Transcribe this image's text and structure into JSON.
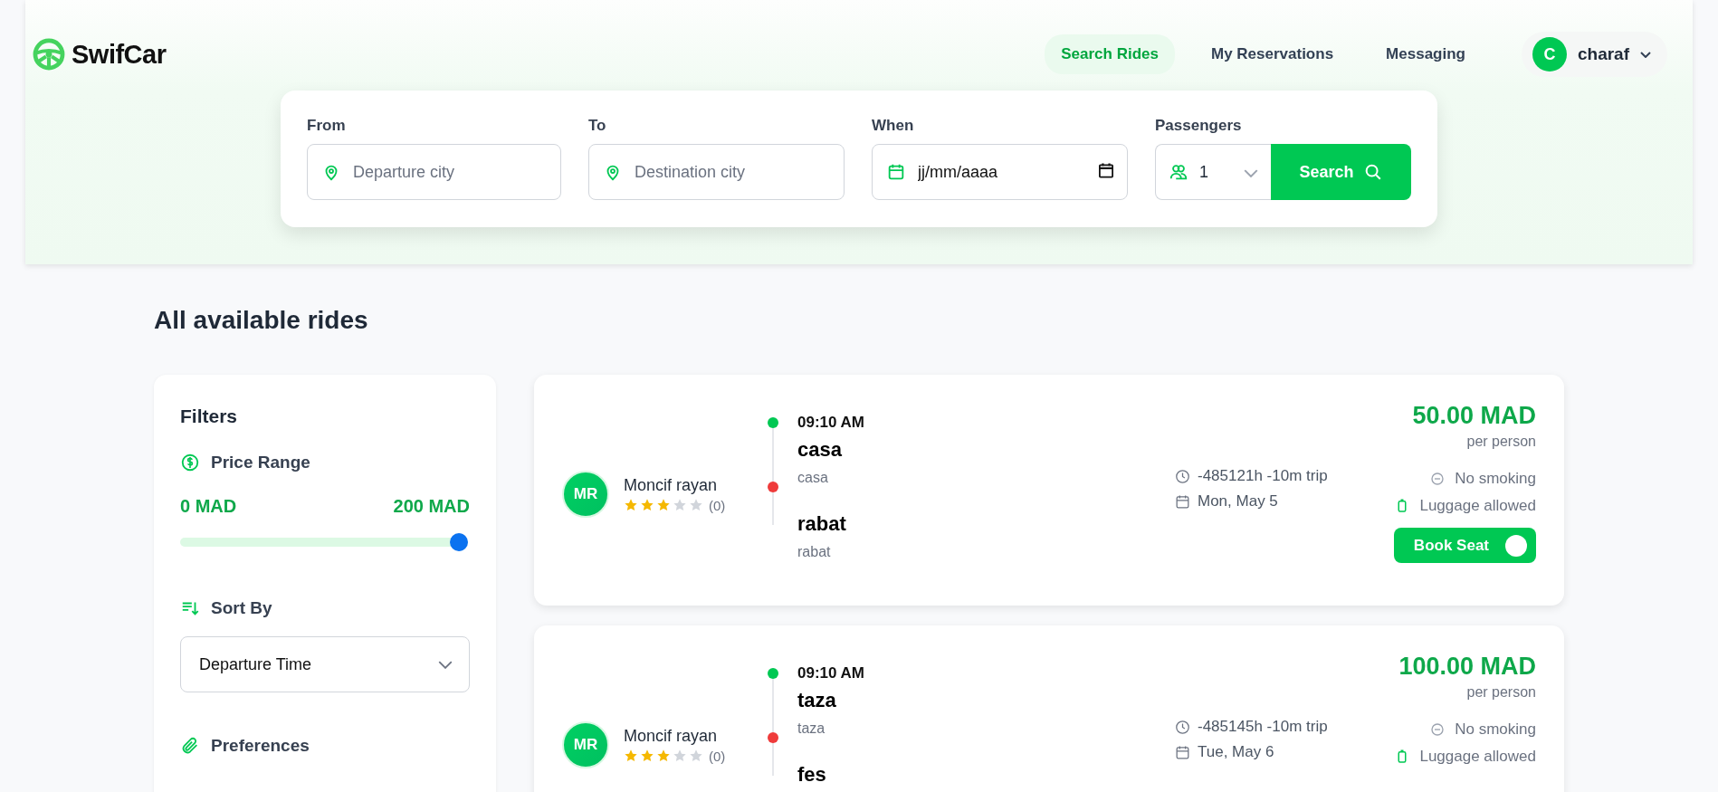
{
  "brand": {
    "name": "SwifCar"
  },
  "nav": [
    {
      "label": "Search Rides",
      "selected": true
    },
    {
      "label": "My Reservations",
      "selected": false
    },
    {
      "label": "Messaging",
      "selected": false
    }
  ],
  "user": {
    "initial": "C",
    "name": "charaf"
  },
  "search": {
    "from": {
      "label": "From",
      "placeholder": "Departure city"
    },
    "to": {
      "label": "To",
      "placeholder": "Destination city"
    },
    "when": {
      "label": "When",
      "placeholder": "jj/mm/aaaa"
    },
    "passengers": {
      "label": "Passengers",
      "value": "1"
    },
    "button": "Search"
  },
  "title": "All available rides",
  "filters": {
    "title": "Filters",
    "price_label": "Price Range",
    "min": "0 MAD",
    "max": "200 MAD",
    "level": 1,
    "sort_label": "Sort By",
    "sort_value": "Departure Time",
    "preferences_label": "Preferences"
  },
  "rides": [
    {
      "initials": "MR",
      "driver": "Moncif rayan",
      "stars": 3,
      "reviews": "(0)",
      "time": "09:10 AM",
      "from": "casa",
      "from_sub": "casa",
      "to": "rabat",
      "to_sub": "rabat",
      "duration": "-485121h -10m trip",
      "date": "Mon, May 5",
      "price": "50.00 MAD",
      "per": "per person",
      "prefs": [
        {
          "kind": "no-smoking",
          "label": "No smoking"
        },
        {
          "kind": "luggage",
          "label": "Luggage allowed"
        }
      ],
      "book": "Book Seat"
    },
    {
      "initials": "MR",
      "driver": "Moncif rayan",
      "stars": 3,
      "reviews": "(0)",
      "time": "09:10 AM",
      "from": "taza",
      "from_sub": "taza",
      "to": "fes",
      "duration": "-485145h -10m trip",
      "date": "Tue, May 6",
      "price": "100.00 MAD",
      "per": "per person",
      "prefs": [
        {
          "kind": "no-smoking",
          "label": "No smoking"
        },
        {
          "kind": "luggage",
          "label": "Luggage allowed"
        }
      ]
    }
  ]
}
